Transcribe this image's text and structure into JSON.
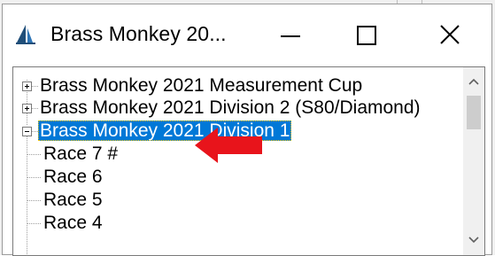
{
  "window": {
    "title": "Brass Monkey 20..."
  },
  "titlebar_buttons": [
    {
      "name": "minimize"
    },
    {
      "name": "maximize"
    },
    {
      "name": "close"
    }
  ],
  "tree": {
    "items": [
      {
        "label": "Brass Monkey 2021 Measurement Cup",
        "expanded": false,
        "selected": false,
        "level": 0
      },
      {
        "label": "Brass Monkey 2021 Division 2 (S80/Diamond)",
        "expanded": false,
        "selected": false,
        "level": 0
      },
      {
        "label": "Brass Monkey 2021 Division 1",
        "expanded": true,
        "selected": true,
        "level": 0
      },
      {
        "label": "Race 7 #",
        "level": 1
      },
      {
        "label": "Race 6",
        "level": 1
      },
      {
        "label": "Race 5",
        "level": 1
      },
      {
        "label": "Race 4",
        "level": 1
      }
    ]
  },
  "annotation": {
    "arrow_color": "#e8141b"
  },
  "colors": {
    "selection": "#0078d7",
    "focus_outline": "#f9c400"
  }
}
